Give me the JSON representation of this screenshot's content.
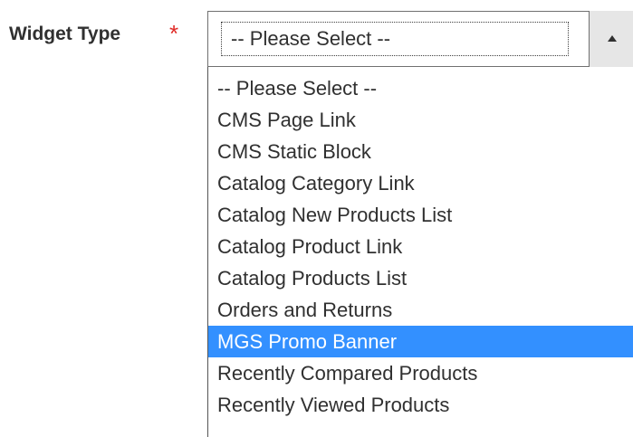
{
  "field": {
    "label": "Widget Type",
    "required_marker": "*",
    "selected_value": "-- Please Select --"
  },
  "dropdown": {
    "highlighted_index": 8,
    "options": [
      "-- Please Select --",
      "CMS Page Link",
      "CMS Static Block",
      "Catalog Category Link",
      "Catalog New Products List",
      "Catalog Product Link",
      "Catalog Products List",
      "Orders and Returns",
      "MGS Promo Banner",
      "Recently Compared Products",
      "Recently Viewed Products"
    ]
  },
  "icons": {
    "toggle_arrow": "chevron-up-icon"
  },
  "colors": {
    "required": "#e02b27",
    "highlight": "#3390ff",
    "text": "#303030"
  }
}
